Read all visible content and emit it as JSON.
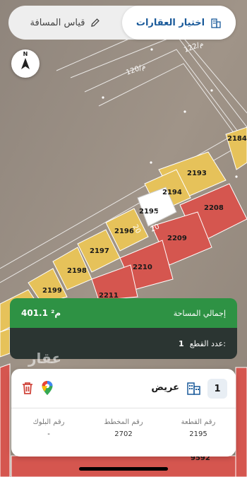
{
  "tabs": {
    "select_properties": "اختيار العقارات",
    "measure_distance": "قياس المسافة"
  },
  "compass": {
    "north_label": "N"
  },
  "map": {
    "plot_labels": [
      "2193",
      "2194",
      "2195",
      "2196",
      "2197",
      "2198",
      "2199",
      "2208",
      "2209",
      "2210",
      "2211",
      "2184",
      "9592"
    ],
    "street_labels": [
      "122/م",
      "120/م",
      "20",
      "20",
      "20"
    ]
  },
  "area_summary": {
    "total_area_label": "إجمالي المساحة",
    "total_area_value": "401.1 م²",
    "plot_count_label": "عدد القطع:",
    "plot_count_value": "1"
  },
  "watermark": "عقار",
  "plot_card": {
    "index": "1",
    "type": "عريض",
    "fields": [
      {
        "key": "رقم القطعة",
        "value": "2195"
      },
      {
        "key": "رقم المخطط",
        "value": "2702"
      },
      {
        "key": "رقم البلوك",
        "value": "-"
      }
    ]
  },
  "colors": {
    "accent_blue": "#1a5a9a",
    "green": "#2e9244",
    "dark": "#2b3532",
    "plot_yellow": "#e6c25a",
    "plot_red": "#d5564f"
  }
}
